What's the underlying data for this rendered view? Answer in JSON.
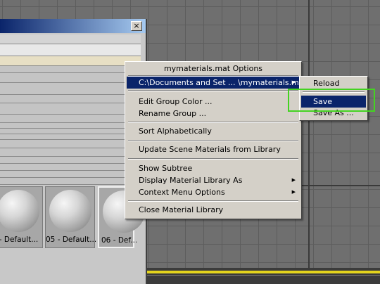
{
  "context_menu": {
    "title": "mymaterials.mat Options",
    "items": [
      {
        "label": "C:\\Documents and Set ... \\mymaterials.mat",
        "has_submenu": true,
        "highlighted": true
      },
      {
        "label": "Edit Group Color ...",
        "has_submenu": false
      },
      {
        "label": "Rename Group ...",
        "has_submenu": false
      },
      {
        "label": "Sort Alphabetically",
        "has_submenu": false
      },
      {
        "label": "Update Scene Materials from Library",
        "has_submenu": false
      },
      {
        "label": "Show Subtree",
        "has_submenu": false
      },
      {
        "label": "Display Material Library As",
        "has_submenu": true
      },
      {
        "label": "Context Menu Options",
        "has_submenu": true
      },
      {
        "label": "Close Material Library",
        "has_submenu": false
      }
    ]
  },
  "file_submenu": {
    "items": [
      {
        "label": "Reload"
      },
      {
        "label": "Save",
        "highlighted": true
      },
      {
        "label": "Save As ..."
      }
    ]
  },
  "material_editor": {
    "close_glyph": "×",
    "slots": [
      {
        "label": "- Default..."
      },
      {
        "label": "05 - Default..."
      },
      {
        "label": "06 - Def..."
      }
    ]
  },
  "colors": {
    "highlight": "#0a246a",
    "callout": "#44d321",
    "timeline": "#e4d41d"
  }
}
